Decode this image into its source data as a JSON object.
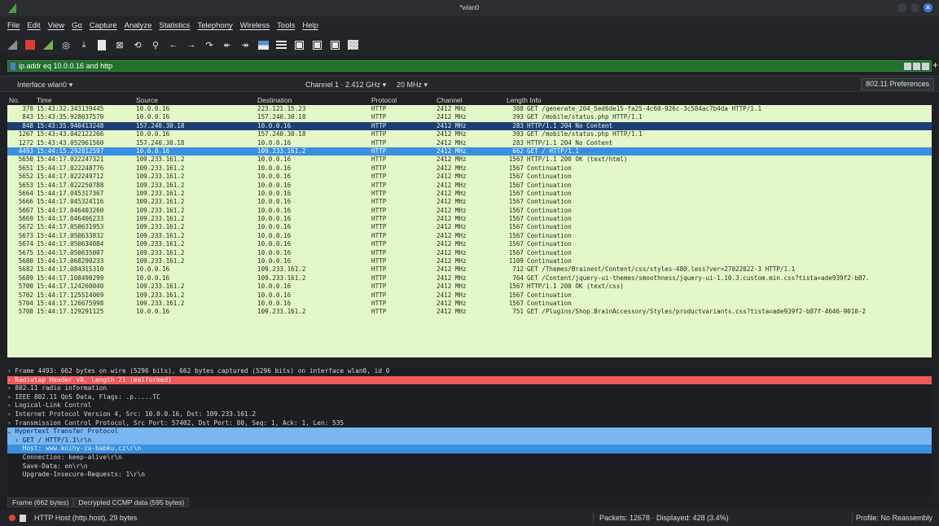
{
  "window": {
    "title": "*wlan0"
  },
  "menu": [
    "File",
    "Edit",
    "View",
    "Go",
    "Capture",
    "Analyze",
    "Statistics",
    "Telephony",
    "Wireless",
    "Tools",
    "Help"
  ],
  "toolbar_icons": [
    "shark-fin-icon",
    "stop-capture-icon",
    "restart-capture-icon",
    "capture-options-icon",
    "open-file-icon",
    "save-file-icon",
    "close-file-icon",
    "reload-file-icon",
    "find-packet-icon",
    "go-back-icon",
    "go-forward-icon",
    "go-to-packet-icon",
    "go-first-icon",
    "go-last-icon",
    "autoscroll-icon",
    "colorize-icon",
    "zoom-in-icon",
    "zoom-out-icon",
    "normal-size-icon",
    "resize-columns-icon"
  ],
  "filter": {
    "text": "ip.addr eq 10.0.0.16 and http"
  },
  "iface": {
    "interface_label": "Interface",
    "interface_value": "wlan0",
    "channel_label": "Channel",
    "channel_value": "1 · 2.412 GHz",
    "width_value": "20 MHz",
    "preferences": "802.11 Preferences"
  },
  "columns": {
    "no": "No.",
    "time": "Time",
    "source": "Source",
    "destination": "Destination",
    "protocol": "Protocol",
    "channel": "Channel",
    "length_info": "Length Info"
  },
  "packets": [
    {
      "no": "378",
      "time": "15:43:32.343139445",
      "src": "10.0.0.16",
      "dst": "223.121.15.23",
      "proto": "HTTP",
      "chan": "2412 MHz",
      "len": "388",
      "info": "GET /generate_204_5ed6de15-fa25-4c60-926c-3c584ac7b4da HTTP/1.1",
      "style": ""
    },
    {
      "no": "843",
      "time": "15:43:35.928037570",
      "src": "10.0.0.16",
      "dst": "157.240.30.18",
      "proto": "HTTP",
      "chan": "2412 MHz",
      "len": "393",
      "info": "GET /mobile/status.php HTTP/1.1",
      "style": ""
    },
    {
      "no": "848",
      "time": "15:43:35.940413248",
      "src": "157.240.30.18",
      "dst": "10.0.0.16",
      "proto": "HTTP",
      "chan": "2412 MHz",
      "len": "283",
      "info": "HTTP/1.1 204 No Content",
      "style": "sel-dark"
    },
    {
      "no": "1267",
      "time": "15:43:43.042122266",
      "src": "10.0.0.16",
      "dst": "157.240.30.18",
      "proto": "HTTP",
      "chan": "2412 MHz",
      "len": "393",
      "info": "GET /mobile/status.php HTTP/1.1",
      "style": ""
    },
    {
      "no": "1272",
      "time": "15:43:43.052961560",
      "src": "157.240.30.18",
      "dst": "10.0.0.16",
      "proto": "HTTP",
      "chan": "2412 MHz",
      "len": "283",
      "info": "HTTP/1.1 204 No Content",
      "style": ""
    },
    {
      "no": "4493",
      "time": "15:44:15.292812597",
      "src": "10.0.0.16",
      "dst": "109.233.161.2",
      "proto": "HTTP",
      "chan": "2412 MHz",
      "len": "662",
      "info": "GET / HTTP/1.1",
      "style": "sel-light"
    },
    {
      "no": "5650",
      "time": "15:44:17.022247321",
      "src": "109.233.161.2",
      "dst": "10.0.0.16",
      "proto": "HTTP",
      "chan": "2412 MHz",
      "len": "1567",
      "info": "HTTP/1.1 200 OK  (text/html)",
      "style": ""
    },
    {
      "no": "5651",
      "time": "15:44:17.022248776",
      "src": "109.233.161.2",
      "dst": "10.0.0.16",
      "proto": "HTTP",
      "chan": "2412 MHz",
      "len": "1567",
      "info": "Continuation",
      "style": ""
    },
    {
      "no": "5652",
      "time": "15:44:17.022249712",
      "src": "109.233.161.2",
      "dst": "10.0.0.16",
      "proto": "HTTP",
      "chan": "2412 MHz",
      "len": "1567",
      "info": "Continuation",
      "style": ""
    },
    {
      "no": "5653",
      "time": "15:44:17.022250788",
      "src": "109.233.161.2",
      "dst": "10.0.0.16",
      "proto": "HTTP",
      "chan": "2412 MHz",
      "len": "1567",
      "info": "Continuation",
      "style": ""
    },
    {
      "no": "5664",
      "time": "15:44:17.045317367",
      "src": "109.233.161.2",
      "dst": "10.0.0.16",
      "proto": "HTTP",
      "chan": "2412 MHz",
      "len": "1567",
      "info": "Continuation",
      "style": ""
    },
    {
      "no": "5666",
      "time": "15:44:17.045324116",
      "src": "109.233.161.2",
      "dst": "10.0.0.16",
      "proto": "HTTP",
      "chan": "2412 MHz",
      "len": "1567",
      "info": "Continuation",
      "style": ""
    },
    {
      "no": "5667",
      "time": "15:44:17.046403260",
      "src": "109.233.161.2",
      "dst": "10.0.0.16",
      "proto": "HTTP",
      "chan": "2412 MHz",
      "len": "1567",
      "info": "Continuation",
      "style": ""
    },
    {
      "no": "5669",
      "time": "15:44:17.046406233",
      "src": "109.233.161.2",
      "dst": "10.0.0.16",
      "proto": "HTTP",
      "chan": "2412 MHz",
      "len": "1567",
      "info": "Continuation",
      "style": ""
    },
    {
      "no": "5672",
      "time": "15:44:17.050631953",
      "src": "109.233.161.2",
      "dst": "10.0.0.16",
      "proto": "HTTP",
      "chan": "2412 MHz",
      "len": "1567",
      "info": "Continuation",
      "style": ""
    },
    {
      "no": "5673",
      "time": "15:44:17.050633832",
      "src": "109.233.161.2",
      "dst": "10.0.0.16",
      "proto": "HTTP",
      "chan": "2412 MHz",
      "len": "1567",
      "info": "Continuation",
      "style": ""
    },
    {
      "no": "5674",
      "time": "15:44:17.050634084",
      "src": "109.233.161.2",
      "dst": "10.0.0.16",
      "proto": "HTTP",
      "chan": "2412 MHz",
      "len": "1567",
      "info": "Continuation",
      "style": ""
    },
    {
      "no": "5675",
      "time": "15:44:17.050635007",
      "src": "109.233.161.2",
      "dst": "10.0.0.16",
      "proto": "HTTP",
      "chan": "2412 MHz",
      "len": "1567",
      "info": "Continuation",
      "style": ""
    },
    {
      "no": "5680",
      "time": "15:44:17.068290233",
      "src": "109.233.161.2",
      "dst": "10.0.0.16",
      "proto": "HTTP",
      "chan": "2412 MHz",
      "len": "1109",
      "info": "Continuation",
      "style": ""
    },
    {
      "no": "5682",
      "time": "15:44:17.084315310",
      "src": "10.0.0.16",
      "dst": "109.233.161.2",
      "proto": "HTTP",
      "chan": "2412 MHz",
      "len": "712",
      "info": "GET /Themes/Brainest/Content/css/styles-480.less?ver=27022022-3 HTTP/1.1",
      "style": ""
    },
    {
      "no": "5689",
      "time": "15:44:17.108490299",
      "src": "10.0.0.16",
      "dst": "109.233.161.2",
      "proto": "HTTP",
      "chan": "2412 MHz",
      "len": "764",
      "info": "GET /Content/jquery-ui-themes/smoothness/jquery-ui-1.10.3.custom.min.css?tista=ade939f2-b87.",
      "style": ""
    },
    {
      "no": "5700",
      "time": "15:44:17.124260040",
      "src": "109.233.161.2",
      "dst": "10.0.0.16",
      "proto": "HTTP",
      "chan": "2412 MHz",
      "len": "1567",
      "info": "HTTP/1.1 200 OK  (text/css)",
      "style": ""
    },
    {
      "no": "5702",
      "time": "15:44:17.125514069",
      "src": "109.233.161.2",
      "dst": "10.0.0.16",
      "proto": "HTTP",
      "chan": "2412 MHz",
      "len": "1567",
      "info": "Continuation",
      "style": ""
    },
    {
      "no": "5704",
      "time": "15:44:17.126675998",
      "src": "109.233.161.2",
      "dst": "10.0.0.16",
      "proto": "HTTP",
      "chan": "2412 MHz",
      "len": "1567",
      "info": "Continuation",
      "style": ""
    },
    {
      "no": "5708",
      "time": "15:44:17.129291125",
      "src": "10.0.0.16",
      "dst": "109.233.161.2",
      "proto": "HTTP",
      "chan": "2412 MHz",
      "len": "751",
      "info": "GET /Plugins/Shop.BrainAccessory/Styles/productvariants.css?tista=ade939f2-b87f-4646-9010-2",
      "style": ""
    }
  ],
  "details": [
    {
      "text": "› Frame 4493: 662 bytes on wire (5296 bits), 662 bytes captured (5296 bits) on interface wlan0, id 0",
      "style": ""
    },
    {
      "text": "› Radiotap Header v0, Length 21 (malformed)",
      "style": "red"
    },
    {
      "text": "› 802.11 radio information",
      "style": ""
    },
    {
      "text": "› IEEE 802.11 QoS Data, Flags: .p.....TC",
      "style": ""
    },
    {
      "text": "› Logical-Link Control",
      "style": ""
    },
    {
      "text": "› Internet Protocol Version 4, Src: 10.0.0.16, Dst: 109.233.161.2",
      "style": ""
    },
    {
      "text": "› Transmission Control Protocol, Src Port: 57402, Dst Port: 80, Seq: 1, Ack: 1, Len: 535",
      "style": ""
    },
    {
      "text": "⌄ Hypertext Transfer Protocol",
      "style": "blue"
    },
    {
      "text": "  › GET / HTTP/1.1\\r\\n",
      "style": "blue"
    },
    {
      "text": "    Host: www.knihy-za-babku.cz\\r\\n",
      "style": "blue-dark"
    },
    {
      "text": "    Connection: keep-alive\\r\\n",
      "style": ""
    },
    {
      "text": "    Save-Data: on\\r\\n",
      "style": ""
    },
    {
      "text": "    Upgrade-Insecure-Requests: 1\\r\\n",
      "style": ""
    }
  ],
  "bytes_tabs": [
    "Frame (662 bytes)",
    "Decrypted CCMP data (595 bytes)"
  ],
  "status": {
    "field": "HTTP Host (http.host), 29 bytes",
    "packets": "Packets: 12678 · Displayed: 428 (3.4%)",
    "profile": "Profile: No Reassembly"
  }
}
